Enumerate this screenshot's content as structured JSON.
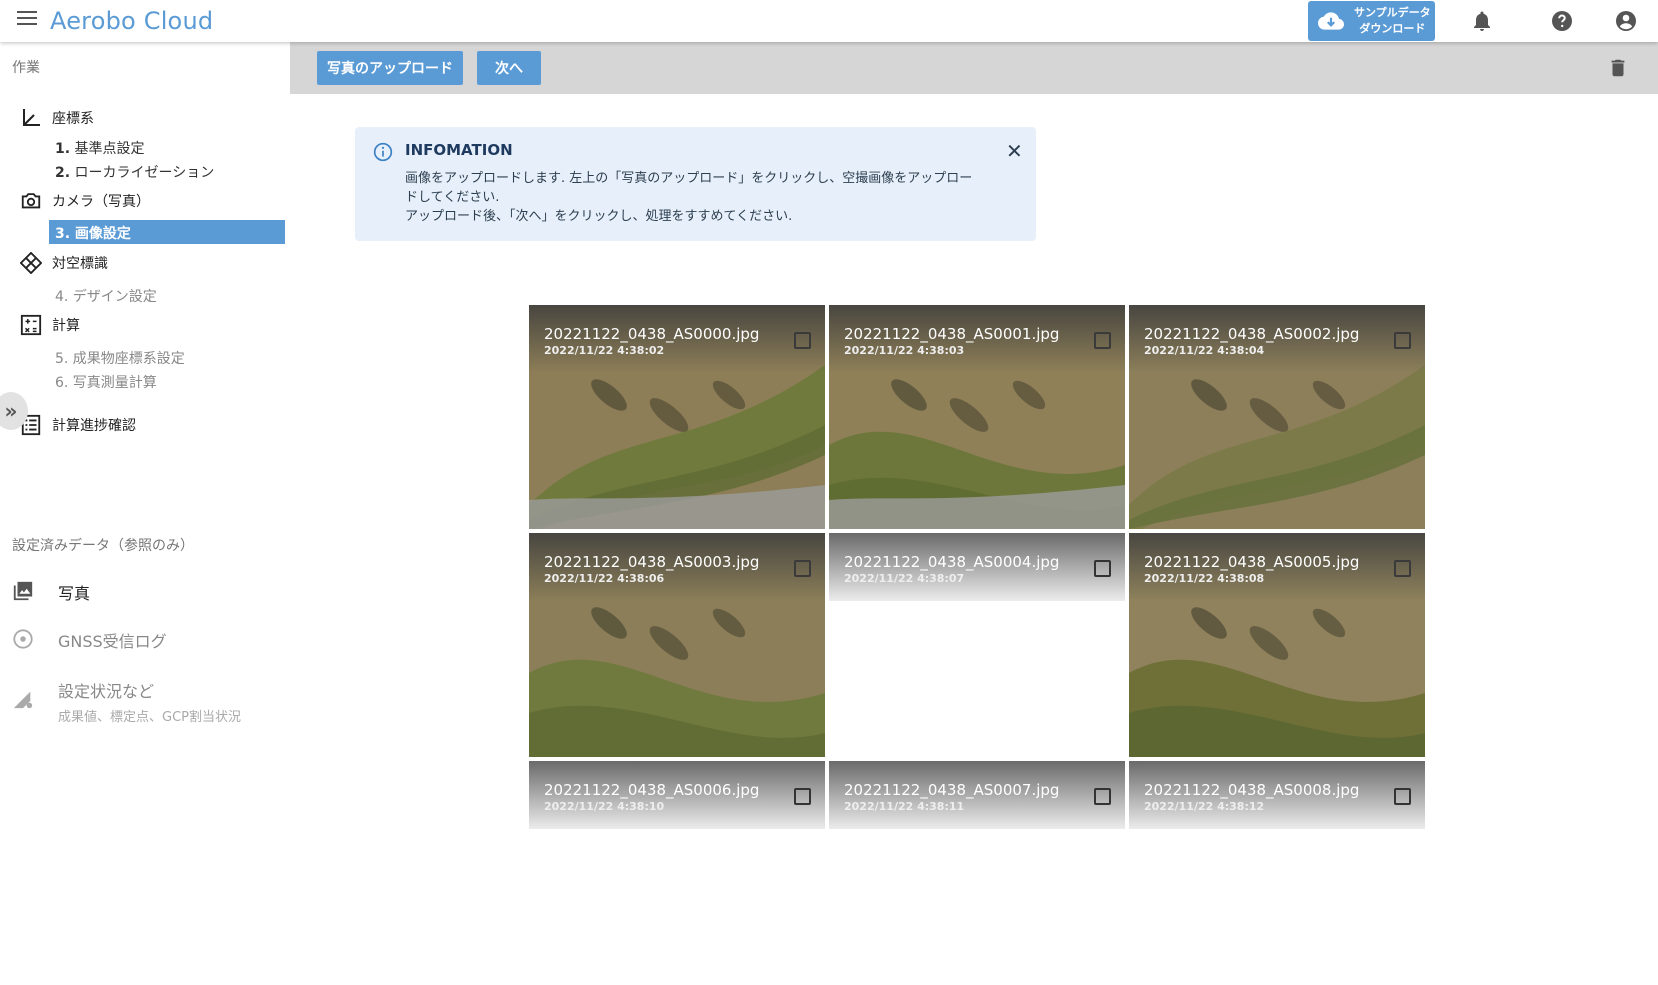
{
  "app": {
    "title": "Aerobo Cloud",
    "sample_download": [
      "サンプルデータ",
      "ダウンロード"
    ],
    "accent": "#5b9bd5"
  },
  "icons": {
    "menu": "hamburger-icon",
    "download": "cloud-download-icon",
    "notify": "bell-icon",
    "help": "help-icon",
    "account": "account-circle-icon",
    "trash": "trash-icon"
  },
  "sidebar": {
    "section_work": "作業",
    "coord": "座標系",
    "step1_num": "1.",
    "step1": "基準点設定",
    "step2_num": "2.",
    "step2": "ローカライゼーション",
    "camera": "カメラ（写真）",
    "step3": "3. 画像設定",
    "target": "対空標識",
    "step4": "4. デザイン設定",
    "calc": "計算",
    "step5": "5. 成果物座標系設定",
    "step6": "6. 写真測量計算",
    "progress": "計算進捗確認",
    "collapse": "»",
    "section_ref": "設定済みデータ（参照のみ）",
    "ref_photo": "写真",
    "ref_gnss": "GNSS受信ログ",
    "ref_status": "設定状況など",
    "ref_status_sub": "成果値、標定点、GCP割当状況"
  },
  "toolbar": {
    "upload": "写真のアップロード",
    "next": "次へ"
  },
  "info": {
    "title": "INFOMATION",
    "line1": "画像をアップロードします. 左上の「写真のアップロード」をクリックし、空撮画像をアップロードしてください.",
    "line2": "アップロード後、「次へ」をクリックし、処理をすすめてください.",
    "close": "✕"
  },
  "photos": [
    {
      "name": "20221122_0438_AS0000.jpg",
      "date": "2022/11/22 4:38:02",
      "loaded": true
    },
    {
      "name": "20221122_0438_AS0001.jpg",
      "date": "2022/11/22 4:38:03",
      "loaded": true
    },
    {
      "name": "20221122_0438_AS0002.jpg",
      "date": "2022/11/22 4:38:04",
      "loaded": true
    },
    {
      "name": "20221122_0438_AS0003.jpg",
      "date": "2022/11/22 4:38:06",
      "loaded": true
    },
    {
      "name": "20221122_0438_AS0004.jpg",
      "date": "2022/11/22 4:38:07",
      "loaded": false
    },
    {
      "name": "20221122_0438_AS0005.jpg",
      "date": "2022/11/22 4:38:08",
      "loaded": true
    },
    {
      "name": "20221122_0438_AS0006.jpg",
      "date": "2022/11/22 4:38:10",
      "loaded": false
    },
    {
      "name": "20221122_0438_AS0007.jpg",
      "date": "2022/11/22 4:38:11",
      "loaded": false
    },
    {
      "name": "20221122_0438_AS0008.jpg",
      "date": "2022/11/22 4:38:12",
      "loaded": false
    }
  ]
}
